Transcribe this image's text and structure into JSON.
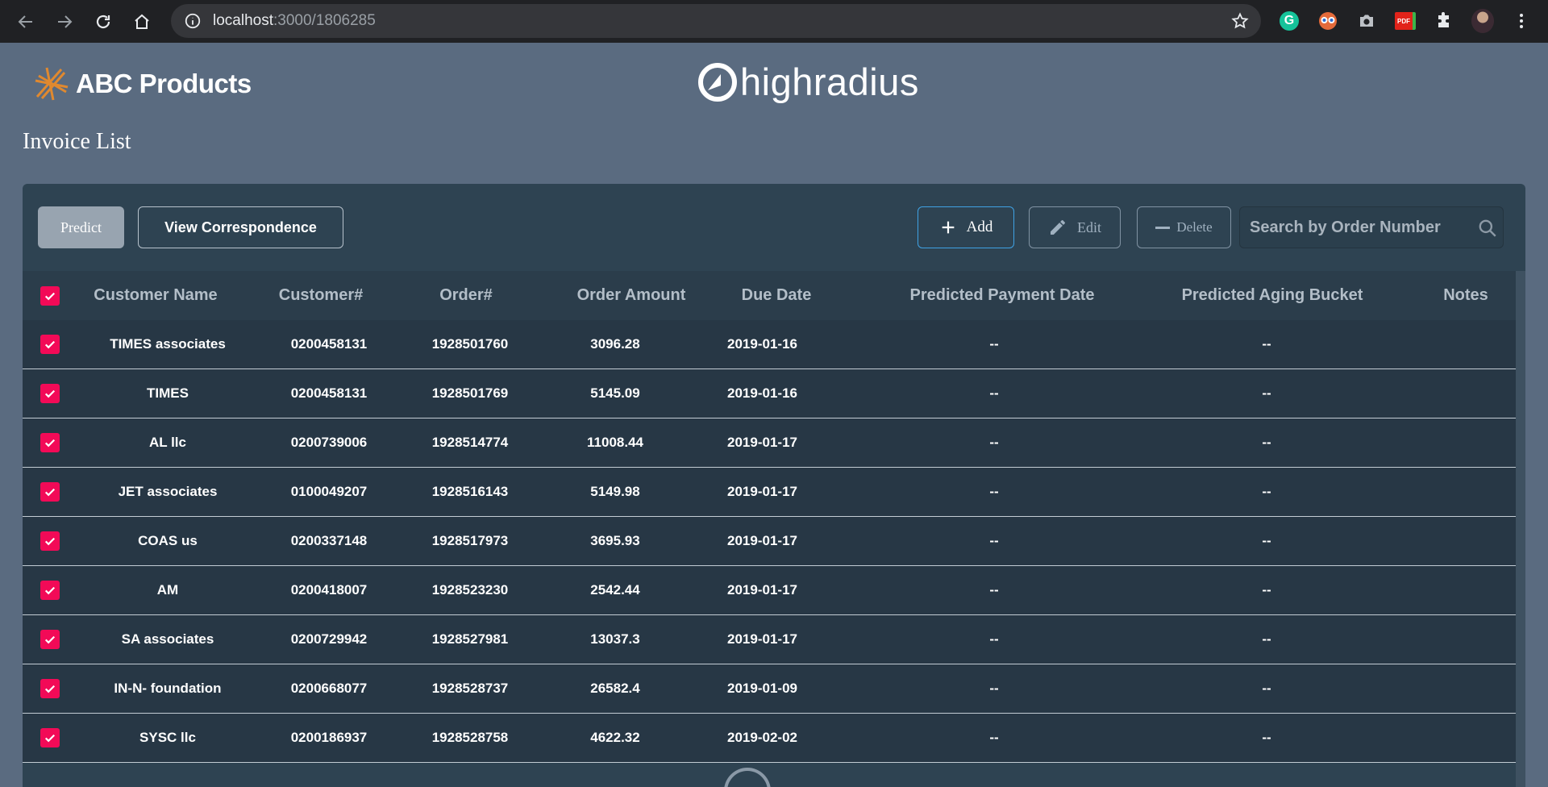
{
  "browser": {
    "url_host": "localhost",
    "url_path": ":3000/1806285",
    "extensions": [
      "grammarly-icon",
      "eyes-icon",
      "camera-icon",
      "pdf-icon",
      "puzzle-icon",
      "avatar-icon",
      "menu-icon"
    ],
    "grammarly_letter": "G",
    "pdf_label": "PDF"
  },
  "header": {
    "brand_name": "ABC Products",
    "partner_logo_text": "highradius",
    "page_title": "Invoice List"
  },
  "toolbar": {
    "predict_label": "Predict",
    "correspondence_label": "View Correspondence",
    "add_label": "Add",
    "edit_label": "Edit",
    "delete_label": "Delete",
    "search_placeholder": "Search by Order Number"
  },
  "table": {
    "columns": [
      "Customer Name",
      "Customer#",
      "Order#",
      "Order Amount",
      "Due Date",
      "Predicted Payment Date",
      "Predicted Aging Bucket",
      "Notes"
    ],
    "rows": [
      {
        "name": "TIMES associates",
        "customer": "0200458131",
        "order": "1928501760",
        "amount": "3096.28",
        "due": "2019-01-16",
        "ppd": "--",
        "pab": "--",
        "notes": ""
      },
      {
        "name": "TIMES",
        "customer": "0200458131",
        "order": "1928501769",
        "amount": "5145.09",
        "due": "2019-01-16",
        "ppd": "--",
        "pab": "--",
        "notes": ""
      },
      {
        "name": "AL llc",
        "customer": "0200739006",
        "order": "1928514774",
        "amount": "11008.44",
        "due": "2019-01-17",
        "ppd": "--",
        "pab": "--",
        "notes": ""
      },
      {
        "name": "JET associates",
        "customer": "0100049207",
        "order": "1928516143",
        "amount": "5149.98",
        "due": "2019-01-17",
        "ppd": "--",
        "pab": "--",
        "notes": ""
      },
      {
        "name": "COAS us",
        "customer": "0200337148",
        "order": "1928517973",
        "amount": "3695.93",
        "due": "2019-01-17",
        "ppd": "--",
        "pab": "--",
        "notes": ""
      },
      {
        "name": "AM",
        "customer": "0200418007",
        "order": "1928523230",
        "amount": "2542.44",
        "due": "2019-01-17",
        "ppd": "--",
        "pab": "--",
        "notes": ""
      },
      {
        "name": "SA associates",
        "customer": "0200729942",
        "order": "1928527981",
        "amount": "13037.3",
        "due": "2019-01-17",
        "ppd": "--",
        "pab": "--",
        "notes": ""
      },
      {
        "name": "IN-N- foundation",
        "customer": "0200668077",
        "order": "1928528737",
        "amount": "26582.4",
        "due": "2019-01-09",
        "ppd": "--",
        "pab": "--",
        "notes": ""
      },
      {
        "name": "SYSC llc",
        "customer": "0200186937",
        "order": "1928528758",
        "amount": "4622.32",
        "due": "2019-02-02",
        "ppd": "--",
        "pab": "--",
        "notes": ""
      }
    ]
  },
  "colors": {
    "page_bg": "#5a6b80",
    "panel_bg": "#2e4352",
    "checkbox": "#f20a57",
    "add_border": "#3fa2e4"
  }
}
